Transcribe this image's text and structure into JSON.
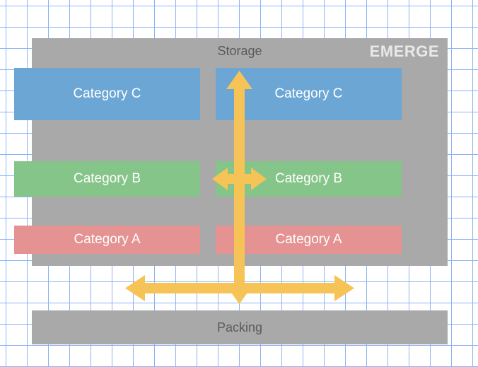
{
  "storage": {
    "title": "Storage",
    "watermark": "EMERGE",
    "rows": [
      {
        "key": "c",
        "left_label": "Category C",
        "right_label": "Category C"
      },
      {
        "key": "b",
        "left_label": "Category B",
        "right_label": "Category B"
      },
      {
        "key": "a",
        "left_label": "Category A",
        "right_label": "Category A"
      }
    ]
  },
  "packing": {
    "label": "Packing"
  },
  "arrows": {
    "color": "#f6c456",
    "vertical": {
      "desc": "double-headed vertical arrow through aisle"
    },
    "mid_horizontal": {
      "desc": "double-headed horizontal arrow at Category B row"
    },
    "bottom_horizontal": {
      "desc": "double-headed horizontal arrow between storage and packing"
    }
  }
}
